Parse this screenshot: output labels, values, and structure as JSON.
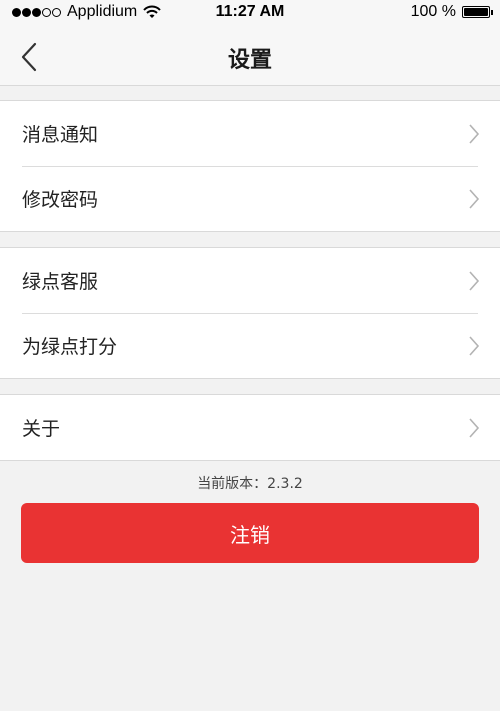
{
  "status_bar": {
    "carrier": "Applidium",
    "time": "11:27 AM",
    "battery": "100 %",
    "icons": [
      "signal-dots-icon",
      "wifi-icon",
      "battery-icon"
    ]
  },
  "nav": {
    "title": "设置",
    "back_icon": "chevron-left-icon"
  },
  "groups": [
    {
      "items": [
        {
          "label": "消息通知"
        },
        {
          "label": "修改密码"
        }
      ]
    },
    {
      "items": [
        {
          "label": "绿点客服"
        },
        {
          "label": "为绿点打分"
        }
      ]
    },
    {
      "items": [
        {
          "label": "关于"
        }
      ]
    }
  ],
  "version_text": "当前版本：2.3.2",
  "logout_label": "注销",
  "colors": {
    "accent": "#e93333",
    "background": "#f2f2f2",
    "nav_background": "#f7f7f7"
  }
}
